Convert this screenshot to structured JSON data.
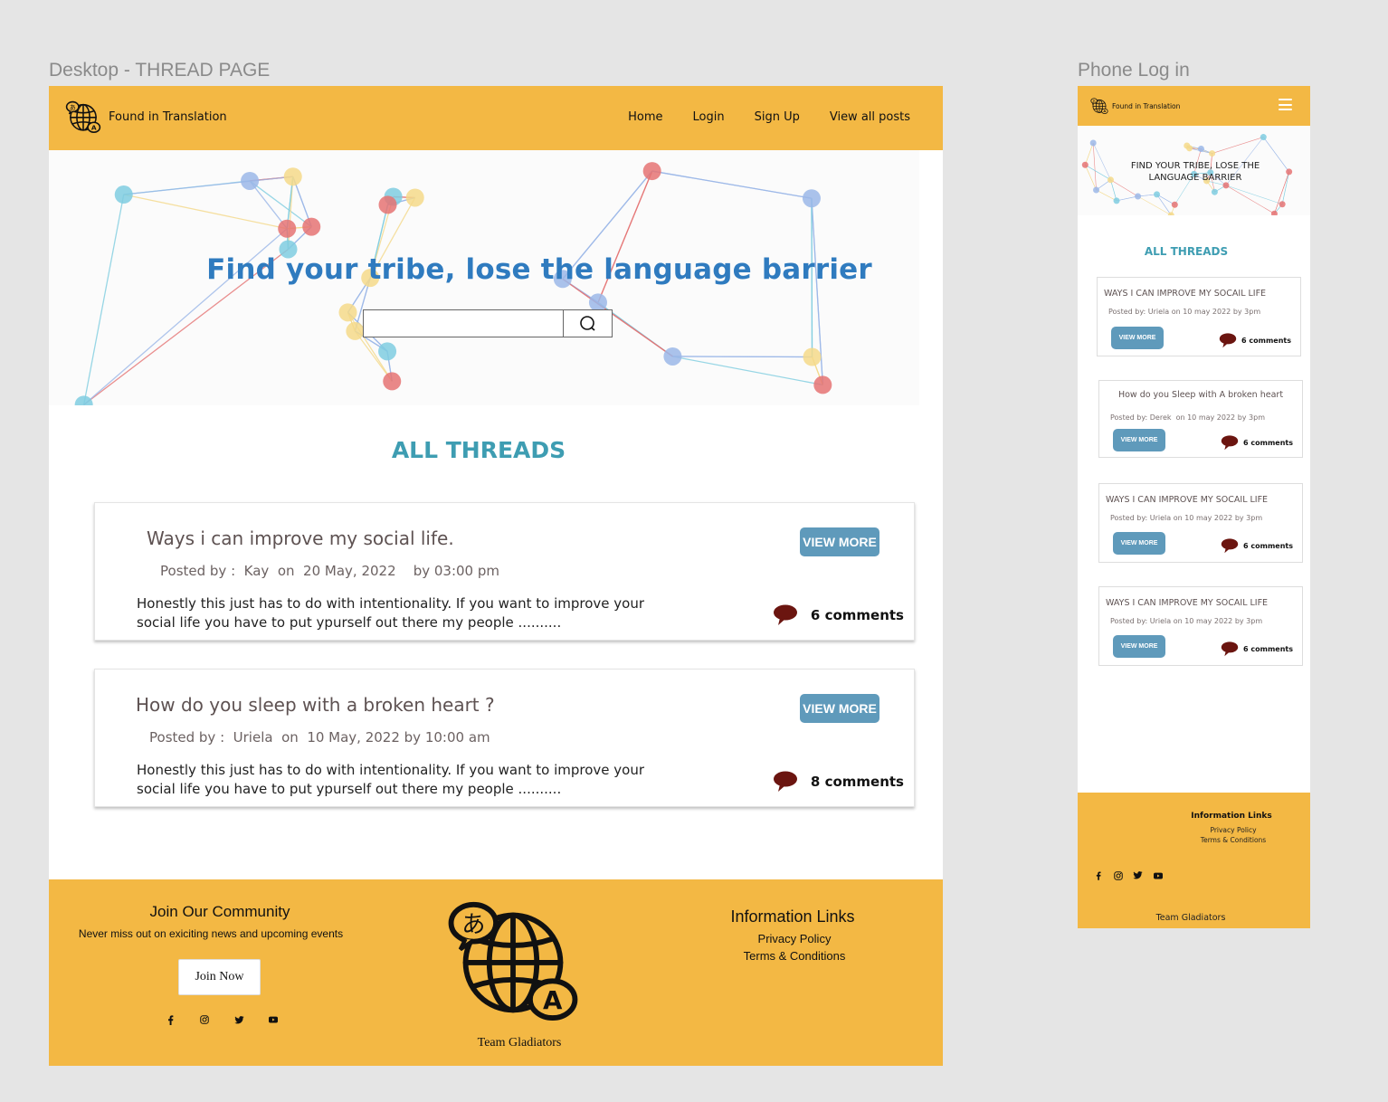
{
  "frames": {
    "desktop_label": "Desktop -  THREAD PAGE",
    "phone_label": "Phone Log in"
  },
  "colors": {
    "nav_bg": "#f3b844",
    "hero_title": "#2f7bbf",
    "threads_title": "#3e9db2",
    "button_bg": "#5f9abb",
    "comment_icon": "#6b1510",
    "card_title": "#5e5252"
  },
  "desktop": {
    "nav": {
      "brand": "Found in Translation",
      "links": [
        "Home",
        "Login",
        "Sign Up",
        "View all posts"
      ]
    },
    "hero": {
      "title": "Find your tribe, lose the language barrier",
      "search_value": "",
      "search_icon": "search-icon"
    },
    "threads_title": "ALL THREADS",
    "threads": [
      {
        "title": "Ways i can improve my social life.",
        "meta": "Posted by :  Kay  on  20 May, 2022    by 03:00 pm",
        "body": "Honestly this just has to do with intentionality. If you want to improve your social life you have to put ypurself out there my people ..........",
        "button": "VIEW MORE",
        "comments": "6 comments"
      },
      {
        "title": "How do you sleep with a broken heart ?",
        "meta": "Posted by :  Uriela  on  10 May, 2022 by 10:00 am",
        "body": "Honestly this just has to do with intentionality. If you want to improve your social life you have to put ypurself out there my people ..........",
        "button": "VIEW MORE",
        "comments": "8 comments"
      }
    ],
    "footer": {
      "join_title": "Join Our Community",
      "join_sub": "Never miss out on exiciting news and upcoming events",
      "join_button": "Join Now",
      "socials": [
        "facebook-icon",
        "instagram-icon",
        "twitter-icon",
        "youtube-icon"
      ],
      "team": "Team Gladiators",
      "info_title": "Information Links",
      "info_links": [
        "Privacy Policy",
        "Terms & Conditions"
      ]
    }
  },
  "phone": {
    "nav": {
      "brand": "Found in Translation",
      "menu_icon": "hamburger-icon"
    },
    "hero_title": "FIND YOUR TRIBE, LOSE THE LANGUAGE BARRIER",
    "threads_title": "ALL THREADS",
    "threads": [
      {
        "title": "WAYS I CAN IMPROVE MY SOCAIL LIFE",
        "meta": "Posted by: Uriela on 10 may 2022 by 3pm",
        "button": "VIEW MORE",
        "comments": "6 comments"
      },
      {
        "title": "How do you Sleep with  A broken heart",
        "meta": "Posted by: Derek  on 10 may 2022 by 3pm",
        "button": "VIEW MORE",
        "comments": "6 comments"
      },
      {
        "title": "WAYS I CAN IMPROVE MY SOCAIL LIFE",
        "meta": "Posted by: Uriela on 10 may 2022 by 3pm",
        "button": "VIEW MORE",
        "comments": "6 comments"
      },
      {
        "title": "WAYS I CAN IMPROVE MY SOCAIL LIFE",
        "meta": "Posted by: Uriela on 10 may 2022 by 3pm",
        "button": "VIEW MORE",
        "comments": "6 comments"
      }
    ],
    "footer": {
      "info_title": "Information Links",
      "info_links": [
        "Privacy Policy",
        "Terms & Conditions"
      ],
      "socials": [
        "facebook-icon",
        "instagram-icon",
        "twitter-icon",
        "youtube-icon"
      ],
      "team": "Team Gladiators"
    }
  }
}
